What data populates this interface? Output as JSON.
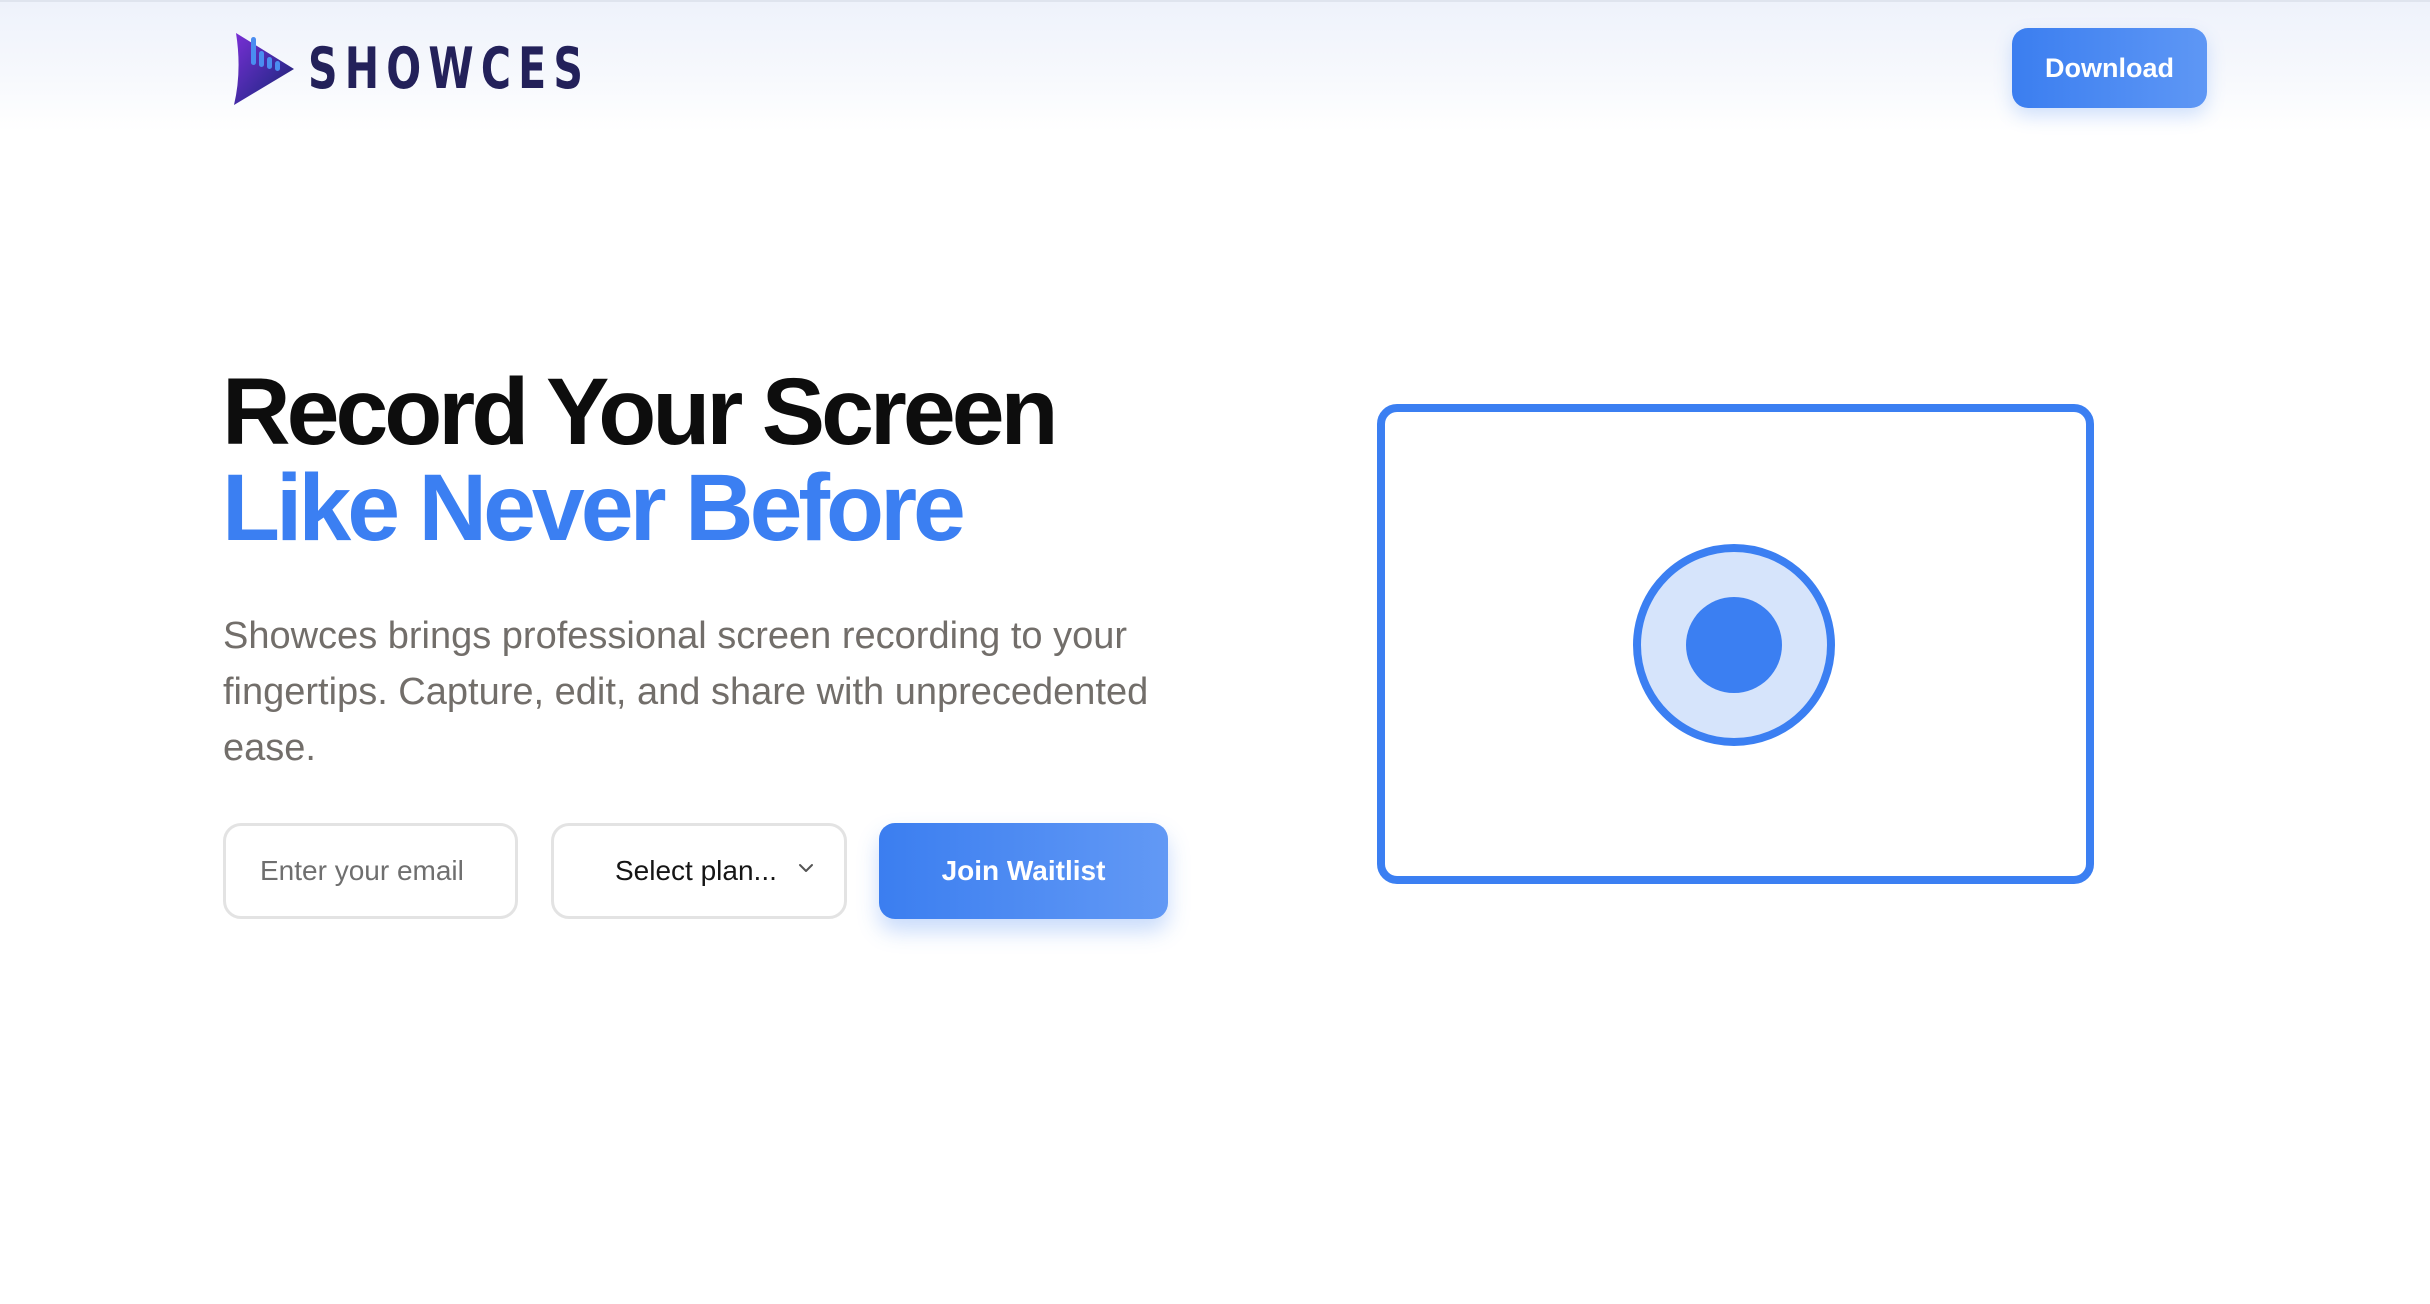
{
  "brand": {
    "name": "SHOWCES",
    "logo_icon": "play-bars-logo-icon"
  },
  "header": {
    "download_label": "Download"
  },
  "hero": {
    "title_line1": "Record Your Screen",
    "title_line2": "Like Never Before",
    "description": "Showces brings professional screen recording to your fingertips. Capture, edit, and share with unprecedented ease."
  },
  "waitlist_form": {
    "email_placeholder": "Enter your email",
    "email_value": "",
    "plan_selected": "Select plan...",
    "join_label": "Join Waitlist"
  },
  "illustration": {
    "frame_icon": "screen-frame",
    "record_icon": "record-icon"
  },
  "colors": {
    "accent": "#3b7ff2",
    "brand_text": "#23215a",
    "heading": "#0d0d0d",
    "body_text": "#726e6a"
  }
}
